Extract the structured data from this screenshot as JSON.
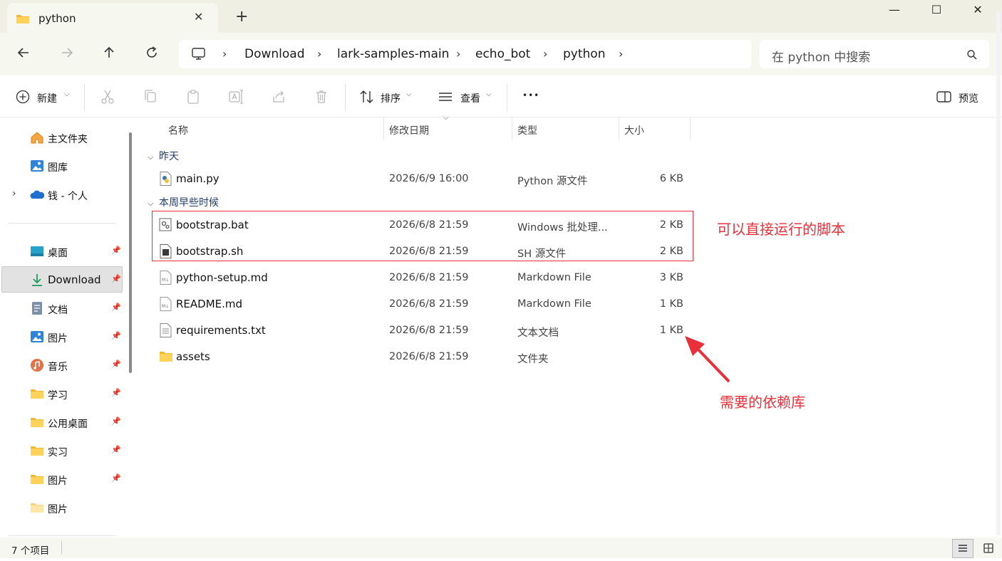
{
  "window": {
    "tab_title": "python",
    "tab_close": "✕",
    "new_tab": "+",
    "minimize": "—",
    "maximize": "☐",
    "close": "✕"
  },
  "nav": {
    "breadcrumb": [
      "Download",
      "lark-samples-main",
      "echo_bot",
      "python"
    ],
    "separator": "›",
    "search_placeholder": "在 python 中搜索"
  },
  "toolbar": {
    "new_label": "新建",
    "sort_label": "排序",
    "view_label": "查看",
    "more_label": "•••",
    "preview_label": "预览"
  },
  "sidebar": {
    "top": [
      {
        "label": "主文件夹",
        "icon": "home-icon"
      },
      {
        "label": "图库",
        "icon": "gallery-icon"
      },
      {
        "label": "钱 - 个人",
        "icon": "onedrive-cloud-icon"
      }
    ],
    "quick": [
      {
        "label": "桌面",
        "icon": "desktop-icon",
        "pinned": true
      },
      {
        "label": "Download",
        "icon": "download-icon",
        "pinned": true
      },
      {
        "label": "文档",
        "icon": "document-icon",
        "pinned": true
      },
      {
        "label": "图片",
        "icon": "pictures-icon",
        "pinned": true
      },
      {
        "label": "音乐",
        "icon": "music-icon",
        "pinned": true
      },
      {
        "label": "学习",
        "icon": "folder-icon",
        "pinned": true
      },
      {
        "label": "公用桌面",
        "icon": "folder-icon",
        "pinned": true
      },
      {
        "label": "实习",
        "icon": "folder-icon",
        "pinned": true
      },
      {
        "label": "图片",
        "icon": "folder-icon",
        "pinned": true
      },
      {
        "label": "图片",
        "icon": "folder-icon",
        "pinned": false
      }
    ]
  },
  "columns": {
    "name": "名称",
    "date": "修改日期",
    "type": "类型",
    "size": "大小"
  },
  "groups": {
    "yesterday": "昨天",
    "this_week": "本周早些时候"
  },
  "files": [
    {
      "name": "main.py",
      "date": "2026/6/9 16:00",
      "type": "Python 源文件",
      "size": "6 KB",
      "icon": "python-file-icon"
    },
    {
      "name": "bootstrap.bat",
      "date": "2026/6/8 21:59",
      "type": "Windows 批处理...",
      "size": "2 KB",
      "icon": "batch-file-icon"
    },
    {
      "name": "bootstrap.sh",
      "date": "2026/6/8 21:59",
      "type": "SH 源文件",
      "size": "2 KB",
      "icon": "shell-file-icon"
    },
    {
      "name": "python-setup.md",
      "date": "2026/6/8 21:59",
      "type": "Markdown File",
      "size": "3 KB",
      "icon": "markdown-file-icon"
    },
    {
      "name": "README.md",
      "date": "2026/6/8 21:59",
      "type": "Markdown File",
      "size": "1 KB",
      "icon": "markdown-file-icon"
    },
    {
      "name": "requirements.txt",
      "date": "2026/6/8 21:59",
      "type": "文本文档",
      "size": "1 KB",
      "icon": "text-file-icon"
    },
    {
      "name": "assets",
      "date": "2026/6/8 21:59",
      "type": "文件夹",
      "size": "",
      "icon": "folder-icon"
    }
  ],
  "annotations": {
    "scripts_note": "可以直接运行的脚本",
    "deps_note": "需要的依赖库",
    "color": "#e8303a"
  },
  "status": {
    "item_count": "7 个项目"
  }
}
